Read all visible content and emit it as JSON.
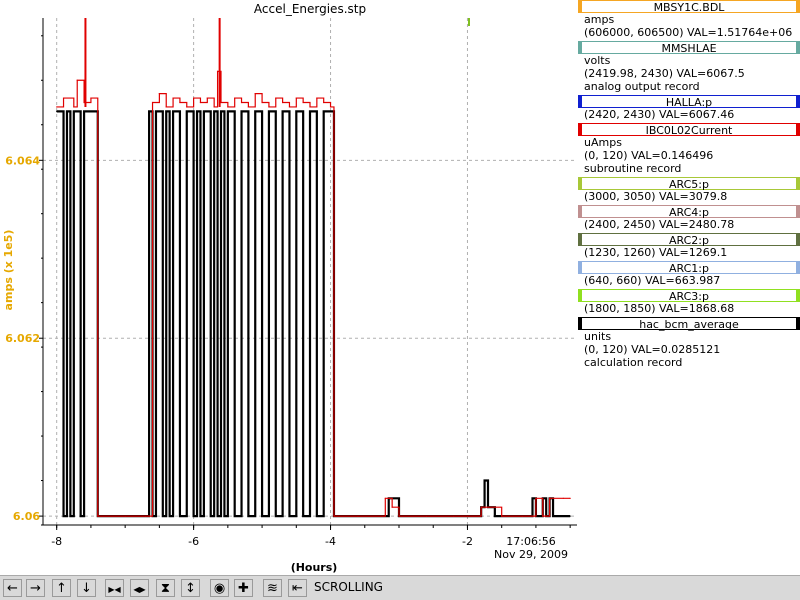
{
  "window": {
    "title": "Accel_Energies.stp"
  },
  "chart_data": {
    "type": "line",
    "title": "Accel_Energies.stp",
    "xlabel": "(Hours)",
    "ylabel": "amps (x 1e5)",
    "xlim": [
      -8.2,
      -0.4
    ],
    "ylim": [
      6.0599,
      6.0656
    ],
    "xticks": [
      -8,
      -6,
      -4,
      -2
    ],
    "yticks": [
      6.06,
      6.062,
      6.064
    ],
    "ytick_labels": [
      "6.06",
      "6.062",
      "6.064"
    ],
    "grid": true,
    "timestamp": [
      "17:06:56",
      "Nov 29, 2009"
    ],
    "axis_color": "#e6a800",
    "series": [
      {
        "name": "MBSY1C.BDL",
        "color": "#000000",
        "x": [
          -8.0,
          -7.95,
          -7.9,
          -7.85,
          -7.8,
          -7.75,
          -7.7,
          -7.65,
          -7.6,
          -7.5,
          -7.45,
          -7.4,
          -7.2,
          -7.0,
          -6.8,
          -6.7,
          -6.65,
          -6.6,
          -6.55,
          -6.5,
          -6.45,
          -6.4,
          -6.35,
          -6.3,
          -6.25,
          -6.2,
          -6.1,
          -6.0,
          -5.95,
          -5.9,
          -5.85,
          -5.8,
          -5.75,
          -5.7,
          -5.65,
          -5.6,
          -5.55,
          -5.5,
          -5.4,
          -5.3,
          -5.2,
          -5.1,
          -5.0,
          -4.9,
          -4.8,
          -4.7,
          -4.6,
          -4.5,
          -4.4,
          -4.3,
          -4.2,
          -4.1,
          -4.0,
          -3.95,
          -3.9,
          -3.8,
          -3.6,
          -3.4,
          -3.2,
          -3.15,
          -3.05,
          -3.0,
          -2.8,
          -2.6,
          -2.4,
          -2.2,
          -2.1,
          -2.0,
          -1.9,
          -1.8,
          -1.75,
          -1.7,
          -1.6,
          -1.55,
          -1.5,
          -1.4,
          -1.3,
          -1.2,
          -1.1,
          -1.05,
          -1.0,
          -0.9,
          -0.85,
          -0.8,
          -0.75,
          -0.7,
          -0.6,
          -0.5
        ],
        "y": [
          6.06455,
          6.06455,
          6.06,
          6.06455,
          6.06,
          6.06455,
          6.06455,
          6.06,
          6.06455,
          6.06455,
          6.06455,
          6.06,
          6.06,
          6.06,
          6.06,
          6.06,
          6.06455,
          6.06,
          6.06455,
          6.06455,
          6.06,
          6.06455,
          6.06,
          6.06455,
          6.06455,
          6.06,
          6.06455,
          6.06,
          6.06455,
          6.06,
          6.06455,
          6.06455,
          6.06,
          6.06455,
          6.06,
          6.06455,
          6.06,
          6.06455,
          6.06,
          6.06455,
          6.06,
          6.06455,
          6.06,
          6.06455,
          6.06,
          6.06455,
          6.06,
          6.06455,
          6.06,
          6.06455,
          6.06,
          6.06455,
          6.06455,
          6.06,
          6.06,
          6.06,
          6.06,
          6.06,
          6.06,
          6.0602,
          6.0602,
          6.06,
          6.06,
          6.06,
          6.06,
          6.06,
          6.06,
          6.06,
          6.06,
          6.0601,
          6.0604,
          6.0601,
          6.06,
          6.06,
          6.06,
          6.06,
          6.06,
          6.06,
          6.06,
          6.0602,
          6.06,
          6.0602,
          6.06,
          6.0602,
          6.06,
          6.06,
          6.06,
          6.06
        ]
      },
      {
        "name": "IBC0L02Current",
        "color": "#e00000",
        "x": [
          -8.0,
          -7.9,
          -7.75,
          -7.7,
          -7.6,
          -7.5,
          -7.4,
          -7.0,
          -6.7,
          -6.6,
          -6.5,
          -6.4,
          -6.3,
          -6.2,
          -6.1,
          -6.0,
          -5.9,
          -5.8,
          -5.7,
          -5.65,
          -5.6,
          -5.5,
          -5.4,
          -5.3,
          -5.2,
          -5.1,
          -5.0,
          -4.9,
          -4.8,
          -4.7,
          -4.6,
          -4.5,
          -4.4,
          -4.3,
          -4.2,
          -4.1,
          -4.0,
          -3.95,
          -3.6,
          -3.2,
          -3.1,
          -3.0,
          -2.6,
          -2.2,
          -2.0,
          -1.8,
          -1.7,
          -1.5,
          -1.2,
          -1.0,
          -0.9,
          -0.8,
          -0.6,
          -0.5
        ],
        "y": [
          6.0646,
          6.0647,
          6.0646,
          6.0649,
          6.06465,
          6.0647,
          6.06,
          6.06,
          6.06,
          6.06465,
          6.06475,
          6.0646,
          6.0647,
          6.06465,
          6.0646,
          6.0647,
          6.06465,
          6.0647,
          6.0646,
          6.065,
          6.06465,
          6.0646,
          6.0647,
          6.06465,
          6.0646,
          6.06475,
          6.06465,
          6.0646,
          6.0647,
          6.06465,
          6.0646,
          6.0647,
          6.06465,
          6.0646,
          6.0647,
          6.06465,
          6.0646,
          6.06,
          6.06,
          6.0602,
          6.0601,
          6.06,
          6.06,
          6.06,
          6.06,
          6.0601,
          6.0601,
          6.06,
          6.06,
          6.0602,
          6.06,
          6.0602,
          6.0602,
          6.0602
        ]
      }
    ]
  },
  "legend": {
    "entries": [
      {
        "name": "MBSY1C.BDL",
        "color": "#f5a623",
        "lines": [
          "amps",
          "(606000, 606500)  VAL=1.51764e+06"
        ]
      },
      {
        "name": "MMSHLAE",
        "color": "#66aaa0",
        "lines": [
          "volts",
          "(2419.98, 2430)  VAL=6067.5",
          "analog output record"
        ]
      },
      {
        "name": "HALLA:p",
        "color": "#1020d0",
        "lines": [
          "(2420, 2430)  VAL=6067.46"
        ]
      },
      {
        "name": "IBC0L02Current",
        "color": "#e00000",
        "lines": [
          "uAmps",
          "(0, 120)  VAL=0.146496",
          "subroutine record"
        ]
      },
      {
        "name": "ARC5:p",
        "color": "#a8c838",
        "lines": [
          "(3000, 3050)  VAL=3079.8"
        ]
      },
      {
        "name": "ARC4:p",
        "color": "#c09090",
        "lines": [
          "(2400, 2450)  VAL=2480.78"
        ]
      },
      {
        "name": "ARC2:p",
        "color": "#607040",
        "lines": [
          "(1230, 1260)  VAL=1269.1"
        ]
      },
      {
        "name": "ARC1:p",
        "color": "#90b0e0",
        "lines": [
          "(640, 660)  VAL=663.987"
        ]
      },
      {
        "name": "ARC3:p",
        "color": "#90e020",
        "lines": [
          "(1800, 1850)  VAL=1868.68"
        ]
      },
      {
        "name": "hac_bcm_average",
        "color": "#000000",
        "lines": [
          "units",
          "(0, 120)  VAL=0.0285121",
          "calculation record"
        ]
      }
    ]
  },
  "toolbar": {
    "buttons": [
      {
        "icon": "arrow-left-icon",
        "glyph": "←"
      },
      {
        "icon": "arrow-right-icon",
        "glyph": "→"
      },
      {
        "icon": "arrow-up-icon",
        "glyph": "↑"
      },
      {
        "icon": "arrow-down-icon",
        "glyph": "↓"
      },
      {
        "icon": "zoom-in-horizontal-icon",
        "glyph": "▶◀"
      },
      {
        "icon": "zoom-out-horizontal-icon",
        "glyph": "◀▶"
      },
      {
        "icon": "zoom-in-vertical-icon",
        "glyph": "⧗"
      },
      {
        "icon": "zoom-out-vertical-icon",
        "glyph": "↕"
      },
      {
        "icon": "record-icon",
        "glyph": "◉"
      },
      {
        "icon": "add-icon",
        "glyph": "✚"
      },
      {
        "icon": "autoscale-icon",
        "glyph": "≋"
      },
      {
        "icon": "scroll-back-icon",
        "glyph": "⇤"
      }
    ],
    "status": "SCROLLING"
  }
}
